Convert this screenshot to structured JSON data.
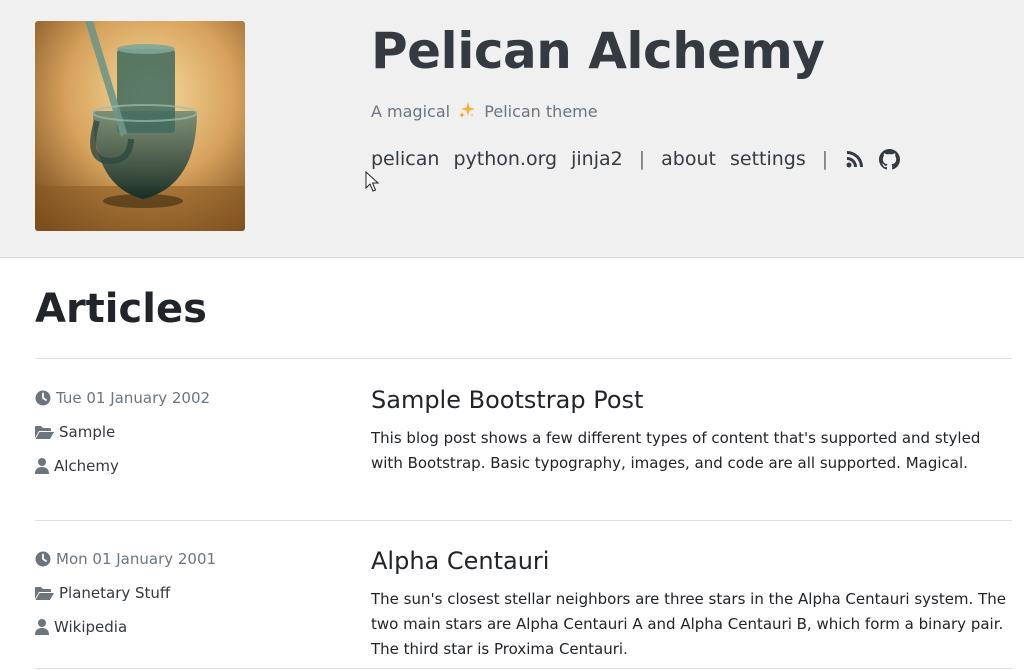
{
  "header": {
    "site_title": "Pelican Alchemy",
    "tagline_before": "A magical",
    "tagline_after": "Pelican theme",
    "nav_links": [
      "pelican",
      "python.org",
      "jinja2"
    ],
    "nav_pages": [
      "about",
      "settings"
    ],
    "separator": "|",
    "icons": [
      "rss-icon",
      "github-icon"
    ]
  },
  "main": {
    "heading": "Articles",
    "articles": [
      {
        "date": "Tue 01 January 2002",
        "category": "Sample",
        "author": "Alchemy",
        "title": "Sample Bootstrap Post",
        "summary": "This blog post shows a few different types of content that's supported and styled with Bootstrap. Basic typography, images, and code are all supported. Magical."
      },
      {
        "date": "Mon 01 January 2001",
        "category": "Planetary Stuff",
        "author": "Wikipedia",
        "title": "Alpha Centauri",
        "summary": "The sun's closest stellar neighbors are three stars in the Alpha Centauri system. The two main stars are Alpha Centauri A and Alpha Centauri B, which form a binary pair. The third star is Proxima Centauri."
      }
    ]
  },
  "colors": {
    "header_bg": "#f0f0f0",
    "title": "#343a40",
    "muted": "#6c757d",
    "rule": "#dee2e6"
  }
}
